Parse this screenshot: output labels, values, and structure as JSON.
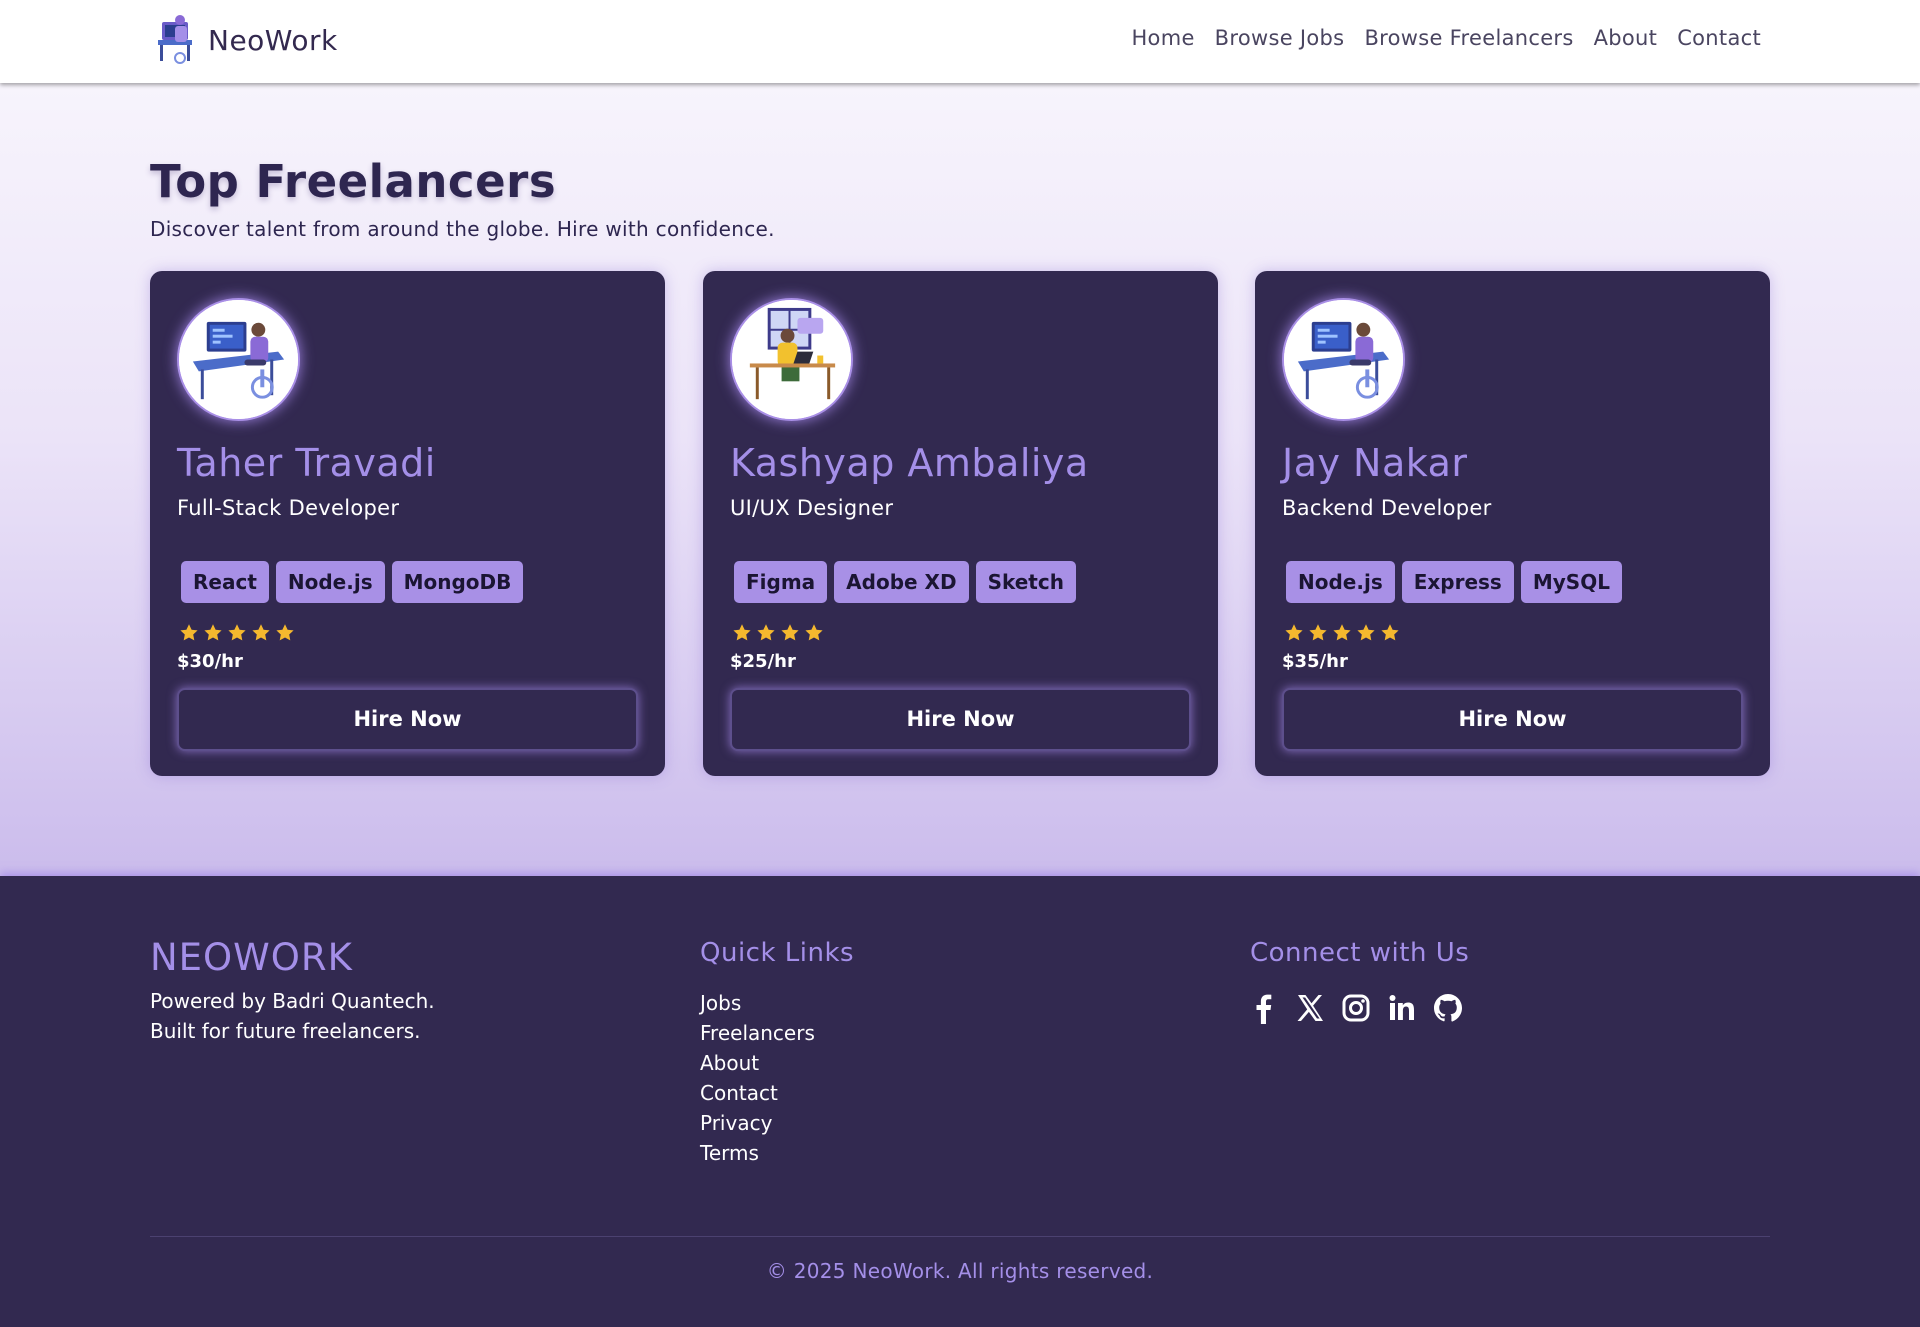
{
  "nav": {
    "brand": "NeoWork",
    "links": [
      "Home",
      "Browse Jobs",
      "Browse Freelancers",
      "About",
      "Contact"
    ]
  },
  "hero": {
    "title": "Top Freelancers",
    "subtitle": "Discover talent from around the globe. Hire with confidence."
  },
  "freelancers": [
    {
      "name": "Taher Travadi",
      "role": "Full-Stack Developer",
      "skills": [
        "React",
        "Node.js",
        "MongoDB"
      ],
      "rating": 5,
      "rate": "$30/hr",
      "button": "Hire Now",
      "avatar": "developer-at-desk-illustration"
    },
    {
      "name": "Kashyap Ambaliya",
      "role": "UI/UX Designer",
      "skills": [
        "Figma",
        "Adobe XD",
        "Sketch"
      ],
      "rating": 4,
      "rate": "$25/hr",
      "button": "Hire Now",
      "avatar": "designer-with-laptop-illustration"
    },
    {
      "name": "Jay Nakar",
      "role": "Backend Developer",
      "skills": [
        "Node.js",
        "Express",
        "MySQL"
      ],
      "rating": 5,
      "rate": "$35/hr",
      "button": "Hire Now",
      "avatar": "developer-at-desk-illustration"
    }
  ],
  "footer": {
    "brand": "NEOWORK",
    "tagline_line1": "Powered by Badri Quantech.",
    "tagline_line2": "Built for future freelancers.",
    "quick_links_title": "Quick Links",
    "quick_links": [
      "Jobs",
      "Freelancers",
      "About",
      "Contact",
      "Privacy",
      "Terms"
    ],
    "connect_title": "Connect with Us",
    "social": [
      "facebook-icon",
      "x-icon",
      "instagram-icon",
      "linkedin-icon",
      "github-icon"
    ],
    "copyright": "© 2025 NeoWork. All rights reserved."
  },
  "colors": {
    "accent": "#a48fe8",
    "card_bg": "#322950",
    "tag_bg": "#a890e6",
    "star": "#f5b82e"
  }
}
